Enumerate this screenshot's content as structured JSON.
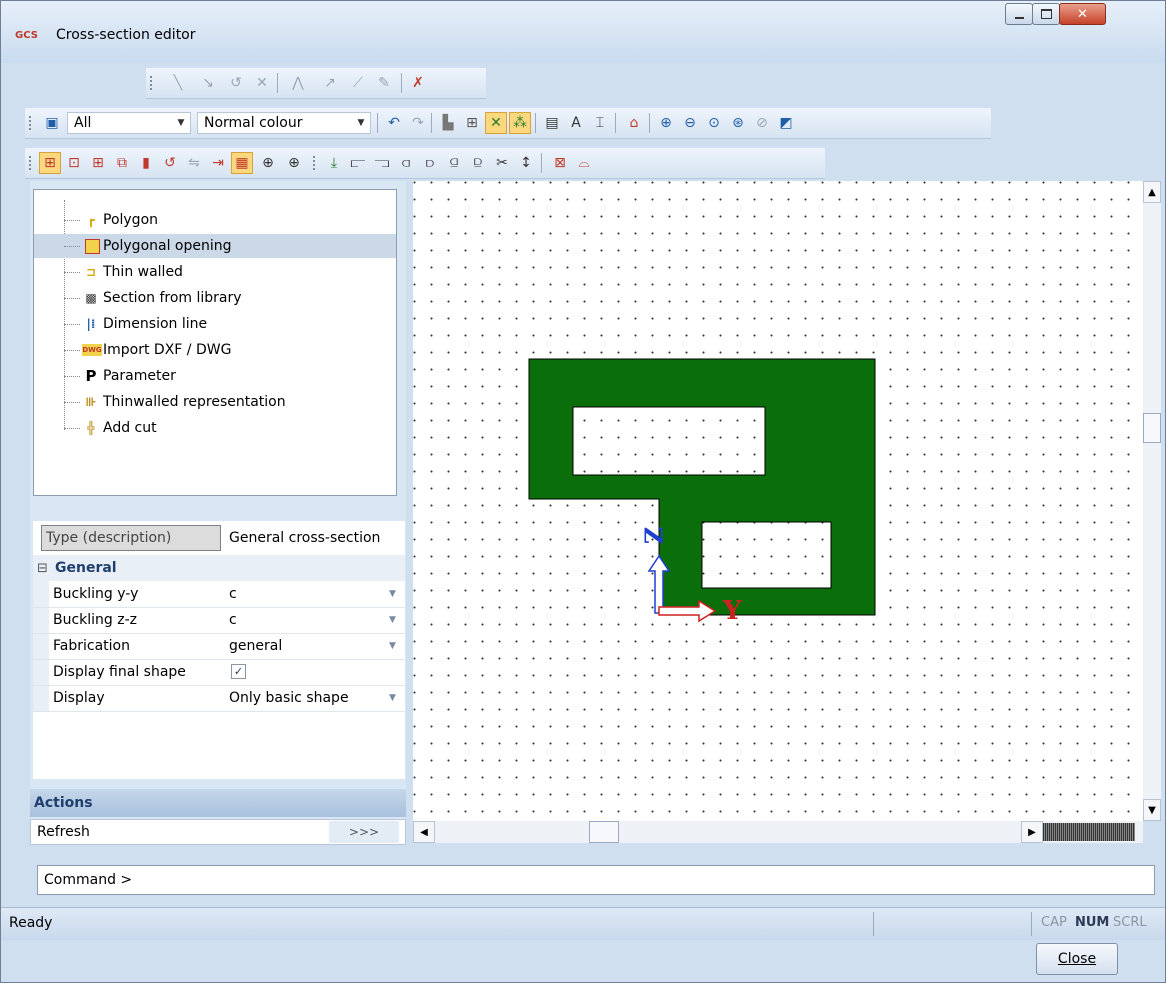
{
  "window": {
    "logo_text": "GCS",
    "title": "Cross-section editor"
  },
  "toolbar": {
    "filter_combo": "All",
    "colour_combo": "Normal colour"
  },
  "tree": {
    "items": [
      {
        "label": "Polygon",
        "icon": "polygon-icon",
        "selected": false
      },
      {
        "label": "Polygonal opening",
        "icon": "polygonal-opening-icon",
        "selected": true
      },
      {
        "label": "Thin walled",
        "icon": "thin-walled-icon",
        "selected": false
      },
      {
        "label": "Section from library",
        "icon": "library-icon",
        "selected": false
      },
      {
        "label": "Dimension line",
        "icon": "dimension-line-icon",
        "selected": false
      },
      {
        "label": "Import DXF / DWG",
        "icon": "dwg-icon",
        "icon_text": "DWG",
        "selected": false
      },
      {
        "label": "Parameter",
        "icon": "parameter-icon",
        "icon_text": "P",
        "selected": false
      },
      {
        "label": "Thinwalled representation",
        "icon": "thinwalled-representation-icon",
        "selected": false
      },
      {
        "label": "Add cut",
        "icon": "add-cut-icon",
        "selected": false
      }
    ]
  },
  "properties": {
    "type_label": "Type (description)",
    "type_value": "General cross-section",
    "group_expander": "⊟",
    "group_title": "General",
    "rows": [
      {
        "name": "Buckling y-y",
        "value": "c",
        "dropdown": true
      },
      {
        "name": "Buckling z-z",
        "value": "c",
        "dropdown": true
      },
      {
        "name": "Fabrication",
        "value": "general",
        "dropdown": true
      },
      {
        "name": "Display final shape",
        "value": "",
        "checkbox": true,
        "checked": true
      },
      {
        "name": "Display",
        "value": "Only basic shape",
        "dropdown": true
      }
    ]
  },
  "actions": {
    "title": "Actions",
    "refresh_label": "Refresh",
    "refresh_button": ">>>"
  },
  "canvas": {
    "axis_z_label": "Z",
    "axis_y_label": "Y",
    "shape_color": "#0a6e0a"
  },
  "command": {
    "label": "Command >"
  },
  "status": {
    "text": "Ready",
    "cap": "CAP",
    "num": "NUM",
    "scrl": "SCRL"
  },
  "buttons": {
    "close": "Close"
  }
}
